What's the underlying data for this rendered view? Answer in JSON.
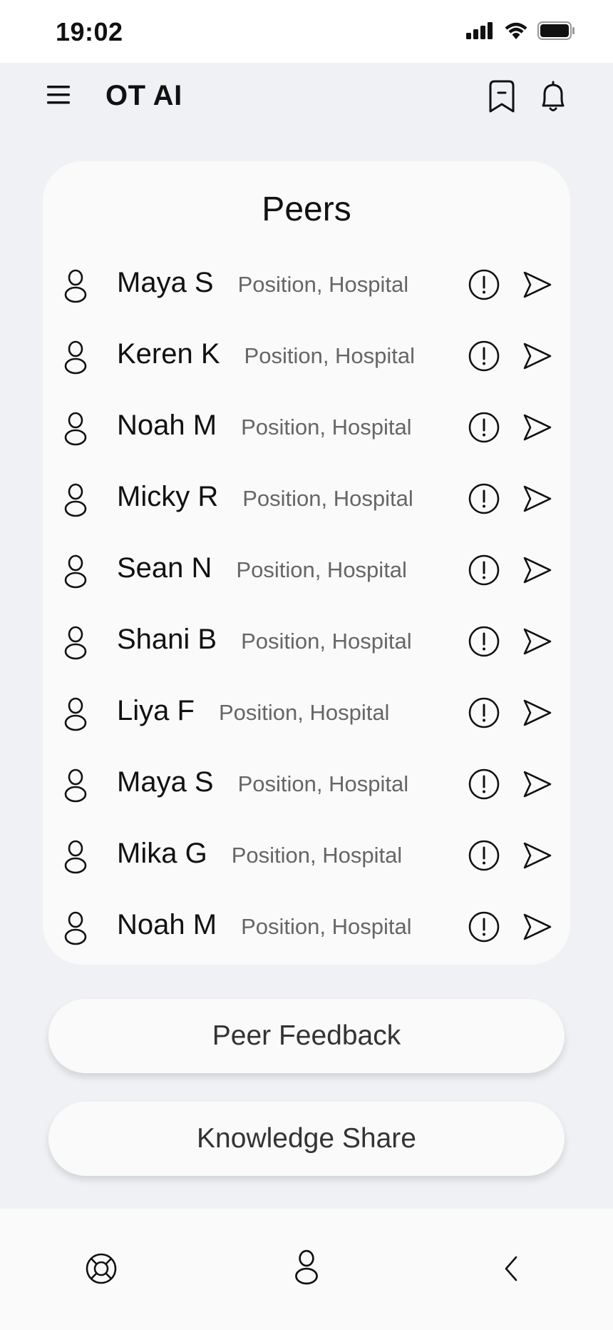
{
  "status_bar": {
    "time": "19:02"
  },
  "app_bar": {
    "title": "OT AI"
  },
  "peers": {
    "title": "Peers",
    "items": [
      {
        "name": "Maya S",
        "meta": "Position, Hospital"
      },
      {
        "name": "Keren K",
        "meta": "Position, Hospital"
      },
      {
        "name": "Noah M",
        "meta": "Position, Hospital"
      },
      {
        "name": "Micky R",
        "meta": "Position, Hospital"
      },
      {
        "name": "Sean N",
        "meta": "Position, Hospital"
      },
      {
        "name": "Shani B",
        "meta": "Position, Hospital"
      },
      {
        "name": "Liya F",
        "meta": "Position, Hospital"
      },
      {
        "name": "Maya S",
        "meta": "Position, Hospital"
      },
      {
        "name": "Mika G",
        "meta": "Position, Hospital"
      },
      {
        "name": "Noah M",
        "meta": "Position, Hospital"
      }
    ]
  },
  "actions": {
    "peer_feedback": "Peer Feedback",
    "knowledge_share": "Knowledge Share"
  },
  "icons": {
    "menu": "menu-icon",
    "bookmark": "bookmark-icon",
    "bell": "bell-icon",
    "person": "person-icon",
    "info": "info-icon",
    "send": "send-icon",
    "support": "lifebuoy-icon",
    "back": "chevron-left-icon"
  }
}
